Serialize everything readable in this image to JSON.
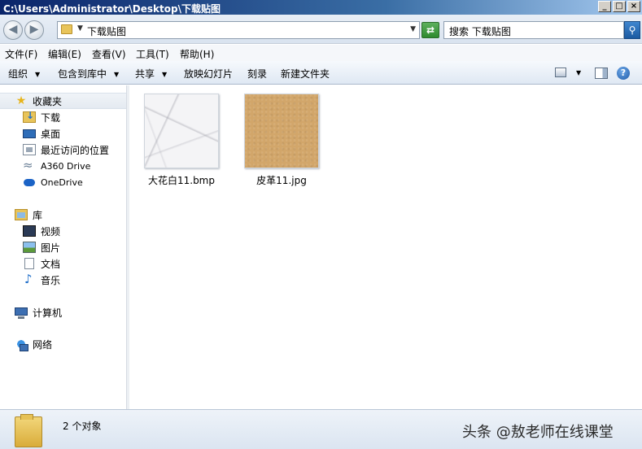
{
  "window": {
    "title": "C:\\Users\\Administrator\\Desktop\\下载贴图",
    "buttons": {
      "minimize": "_",
      "maximize": "□",
      "close": "×"
    }
  },
  "address": {
    "path": "下载贴图",
    "search_placeholder": "搜索 下载贴图"
  },
  "menu": [
    "文件(F)",
    "编辑(E)",
    "查看(V)",
    "工具(T)",
    "帮助(H)"
  ],
  "toolbar": {
    "organize": "组织",
    "include_library": "包含到库中",
    "share": "共享",
    "slideshow": "放映幻灯片",
    "burn": "刻录",
    "new_folder": "新建文件夹"
  },
  "sidebar": {
    "favorites": "收藏夹",
    "fav_items": [
      "下载",
      "桌面",
      "最近访问的位置",
      "A360 Drive",
      "OneDrive"
    ],
    "libraries": "库",
    "lib_items": [
      "视频",
      "图片",
      "文档",
      "音乐"
    ],
    "computer": "计算机",
    "network": "网络"
  },
  "files": [
    {
      "name": "大花白11.bmp",
      "thumb": "marble"
    },
    {
      "name": "皮革11.jpg",
      "thumb": "leather"
    }
  ],
  "status": {
    "count": "2 个对象",
    "watermark": "头条 @敖老师在线课堂"
  }
}
